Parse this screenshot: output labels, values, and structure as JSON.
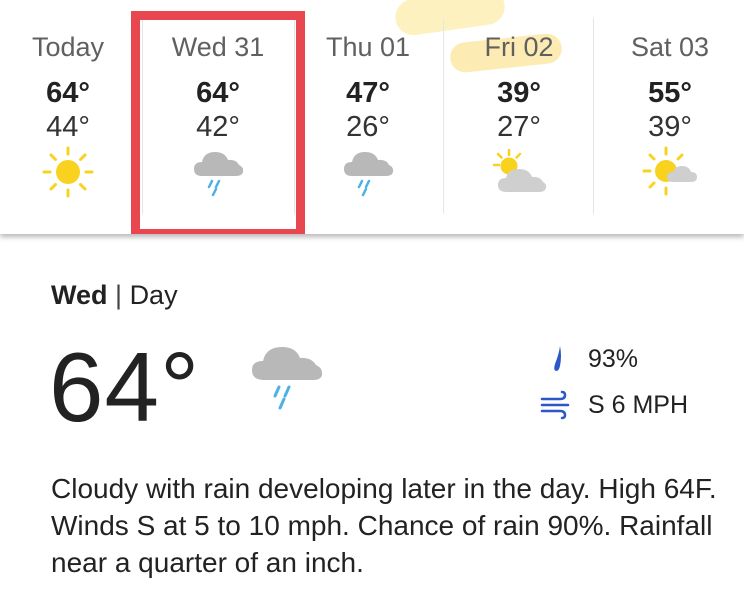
{
  "colors": {
    "selection_border": "#e8474f",
    "sun": "#f8d21f",
    "cloud": "#b8b8b8",
    "rain": "#4db1e6",
    "stat_icon": "#2b57c9"
  },
  "forecast": [
    {
      "day": "Today",
      "high": "64°",
      "low": "44°",
      "icon": "sunny-icon"
    },
    {
      "day": "Wed 31",
      "high": "64°",
      "low": "42°",
      "icon": "rain-cloud-icon",
      "selected": true
    },
    {
      "day": "Thu 01",
      "high": "47°",
      "low": "26°",
      "icon": "rain-cloud-icon"
    },
    {
      "day": "Fri 02",
      "high": "39°",
      "low": "27°",
      "icon": "partly-cloudy-icon"
    },
    {
      "day": "Sat 03",
      "high": "55°",
      "low": "39°",
      "icon": "mostly-sunny-icon"
    }
  ],
  "detail": {
    "day": "Wed",
    "separator": "|",
    "period": "Day",
    "temperature": "64°",
    "icon": "rain-cloud-icon",
    "precip_chance": "93%",
    "wind": "S 6 MPH",
    "description": "Cloudy with rain developing later in the day. High 64F. Winds S at 5 to 10 mph. Chance of rain 90%. Rainfall near a quarter of an inch."
  }
}
